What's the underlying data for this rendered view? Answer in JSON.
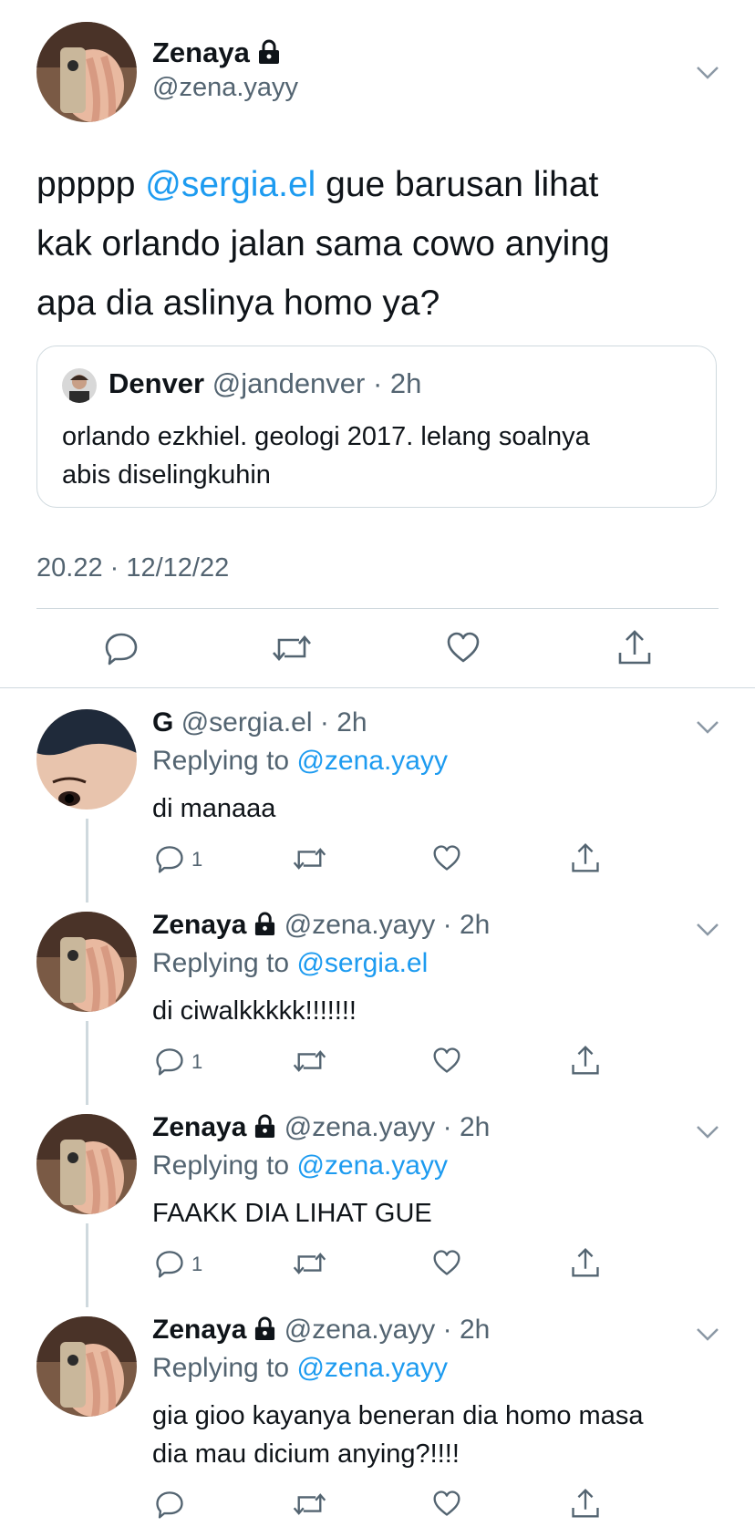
{
  "main_tweet": {
    "author_name": "Zenaya",
    "author_handle": "@zena.yayy",
    "text_prefix": "ppppp ",
    "mention": "@sergia.el",
    "text_line1_rest": " gue barusan lihat",
    "text_line2": "kak orlando jalan sama cowo anying",
    "text_line3": "apa dia aslinya homo ya?",
    "quote": {
      "author_name": "Denver",
      "author_handle": "@jandenver",
      "time": "2h",
      "text_line1": "orlando ezkhiel. geologi 2017. lelang soalnya",
      "text_line2": "abis diselingkuhin"
    },
    "timestamp": "20.22 · 12/12/22"
  },
  "replies": [
    {
      "author_name": "G",
      "author_handle": "@sergia.el",
      "time": "2h",
      "replying_label": "Replying to",
      "replying_to": "@zena.yayy",
      "text_line1": "di manaaa",
      "text_line2": "",
      "reply_count": "1"
    },
    {
      "author_name": "Zenaya",
      "author_handle": "@zena.yayy",
      "time": "2h",
      "replying_label": "Replying to",
      "replying_to": "@sergia.el",
      "text_line1": "di ciwalkkkkk!!!!!!!",
      "text_line2": "",
      "reply_count": "1"
    },
    {
      "author_name": "Zenaya",
      "author_handle": "@zena.yayy",
      "time": "2h",
      "replying_label": "Replying to",
      "replying_to": "@zena.yayy",
      "text_line1": "FAAKK DIA LIHAT GUE",
      "text_line2": "",
      "reply_count": "1"
    },
    {
      "author_name": "Zenaya",
      "author_handle": "@zena.yayy",
      "time": "2h",
      "replying_label": "Replying to",
      "replying_to": "@zena.yayy",
      "text_line1": "gia gioo kayanya beneran dia homo masa",
      "text_line2": "dia mau dicium anying?!!!!",
      "reply_count": ""
    }
  ],
  "colors": {
    "accent": "#1d9bf0",
    "secondary_text": "#536471",
    "divider": "#cfd9de"
  },
  "icons": [
    "lock-icon",
    "chevron-down-icon",
    "reply-icon",
    "retweet-icon",
    "like-icon",
    "share-icon"
  ]
}
